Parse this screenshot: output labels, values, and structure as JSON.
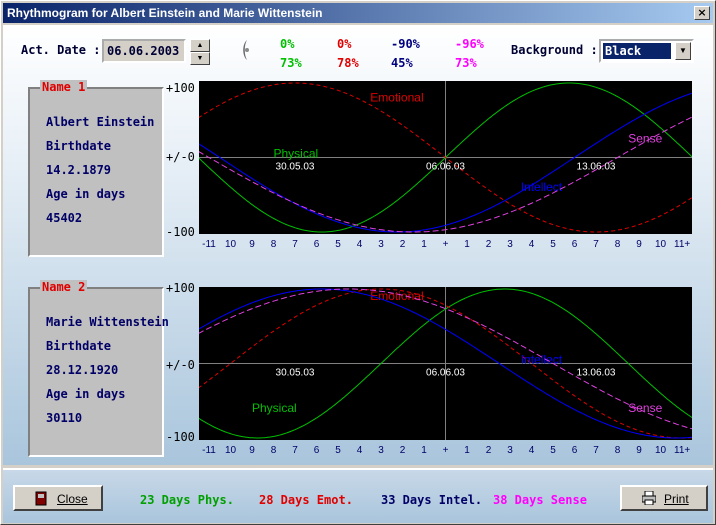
{
  "window": {
    "title": "Rhythmogram for Albert Einstein and Marie Wittenstein"
  },
  "controls": {
    "act_date_label": "Act. Date :",
    "act_date_value": "06.06.2003",
    "background_label": "Background :",
    "background_value": "Black"
  },
  "percentages": {
    "row1": [
      "0%",
      "0%",
      "-90%",
      "-96%"
    ],
    "row2": [
      "73%",
      "78%",
      "45%",
      "73%"
    ]
  },
  "colors": {
    "physical": "#00c000",
    "emotional": "#e00000",
    "intellectual": "#000080",
    "sense": "#ff00ff",
    "chart_bg": "#000000"
  },
  "persons": [
    {
      "legend": "Name 1",
      "name": "Albert Einstein",
      "birthdate_label": "Birthdate",
      "birthdate": "14.2.1879",
      "age_label": "Age in days",
      "age_days": "45402"
    },
    {
      "legend": "Name 2",
      "name": "Marie Wittenstein",
      "birthdate_label": "Birthdate",
      "birthdate": "28.12.1920",
      "age_label": "Age in days",
      "age_days": "30110"
    }
  ],
  "chart_data": [
    {
      "type": "line",
      "y_tick_labels": [
        "+100",
        "+/-0",
        "-100"
      ],
      "ylim": [
        -100,
        100
      ],
      "x_tick_labels": [
        "-11",
        "10",
        "9",
        "8",
        "7",
        "6",
        "5",
        "4",
        "3",
        "2",
        "1",
        "+",
        "1",
        "2",
        "3",
        "4",
        "5",
        "6",
        "7",
        "8",
        "9",
        "10",
        "11+"
      ],
      "x_range_days": [
        -11,
        11
      ],
      "date_labels": [
        {
          "day": -7,
          "text": "30.05.03"
        },
        {
          "day": 0,
          "text": "06.06.03"
        },
        {
          "day": 7,
          "text": "13.06.03"
        }
      ],
      "series": [
        {
          "name": "Physical",
          "period": 23,
          "age_days": 45402,
          "label_day": -8,
          "label_value": 0
        },
        {
          "name": "Emotional",
          "period": 28,
          "age_days": 45402,
          "label_day": -3.5,
          "label_value": 75
        },
        {
          "name": "Intellect",
          "period": 33,
          "age_days": 45402,
          "label_day": 3.5,
          "label_value": -45
        },
        {
          "name": "Sense",
          "period": 38,
          "age_days": 45402,
          "label_day": 8.5,
          "label_value": 20
        }
      ]
    },
    {
      "type": "line",
      "y_tick_labels": [
        "+100",
        "+/-0",
        "-100"
      ],
      "ylim": [
        -100,
        100
      ],
      "x_tick_labels": [
        "-11",
        "10",
        "9",
        "8",
        "7",
        "6",
        "5",
        "4",
        "3",
        "2",
        "1",
        "+",
        "1",
        "2",
        "3",
        "4",
        "5",
        "6",
        "7",
        "8",
        "9",
        "10",
        "11+"
      ],
      "x_range_days": [
        -11,
        11
      ],
      "date_labels": [
        {
          "day": -7,
          "text": "30.05.03"
        },
        {
          "day": 0,
          "text": "06.06.03"
        },
        {
          "day": 7,
          "text": "13.06.03"
        }
      ],
      "series": [
        {
          "name": "Physical",
          "period": 23,
          "age_days": 30110,
          "label_day": -9,
          "label_value": -65
        },
        {
          "name": "Emotional",
          "period": 28,
          "age_days": 30110,
          "label_day": -3.5,
          "label_value": 85
        },
        {
          "name": "Intellect",
          "period": 33,
          "age_days": 30110,
          "label_day": 3.5,
          "label_value": 0
        },
        {
          "name": "Sense",
          "period": 38,
          "age_days": 30110,
          "label_day": 8.5,
          "label_value": -65
        }
      ]
    }
  ],
  "footer": {
    "close_label": "Close",
    "print_label": "Print",
    "cycles": [
      "23 Days Phys.",
      "28 Days Emot.",
      "33 Days Intel.",
      "38 Days Sense"
    ]
  }
}
